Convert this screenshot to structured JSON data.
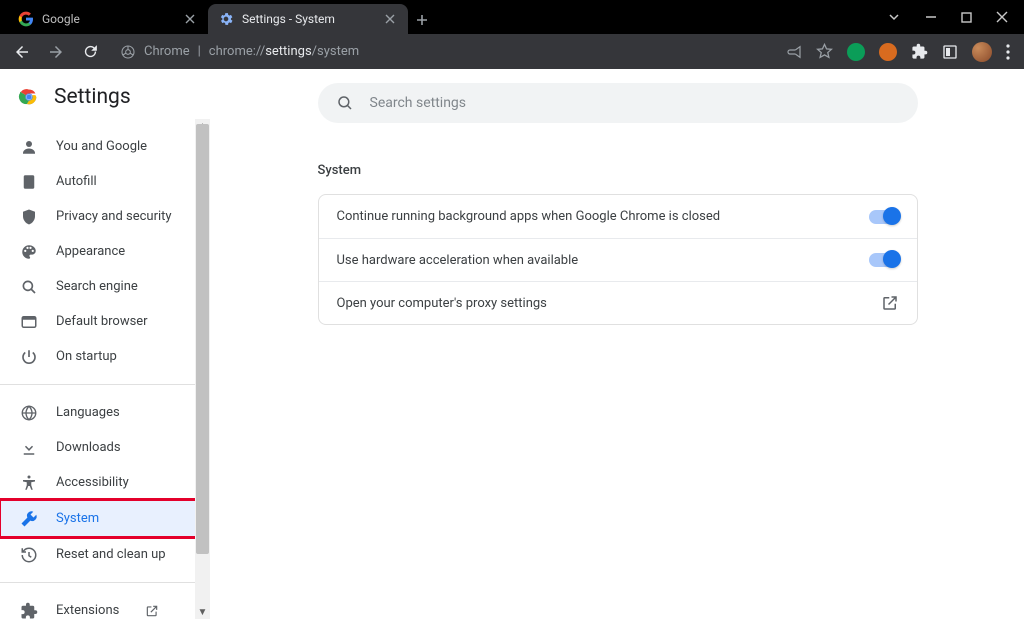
{
  "window": {
    "tabs": [
      {
        "title": "Google",
        "active": false
      },
      {
        "title": "Settings - System",
        "active": true
      }
    ]
  },
  "addressbar": {
    "chrome_label": "Chrome",
    "url_prefix": "chrome://",
    "url_bold": "settings",
    "url_suffix": "/system"
  },
  "settings": {
    "title": "Settings",
    "search_placeholder": "Search settings",
    "section_title": "System",
    "sidebar": {
      "group1": [
        {
          "key": "you-and-google",
          "label": "You and Google",
          "icon": "person"
        },
        {
          "key": "autofill",
          "label": "Autofill",
          "icon": "assignment"
        },
        {
          "key": "privacy",
          "label": "Privacy and security",
          "icon": "shield"
        },
        {
          "key": "appearance",
          "label": "Appearance",
          "icon": "palette"
        },
        {
          "key": "search-engine",
          "label": "Search engine",
          "icon": "search"
        },
        {
          "key": "default-browser",
          "label": "Default browser",
          "icon": "browser"
        },
        {
          "key": "on-startup",
          "label": "On startup",
          "icon": "power"
        }
      ],
      "group2": [
        {
          "key": "languages",
          "label": "Languages",
          "icon": "globe"
        },
        {
          "key": "downloads",
          "label": "Downloads",
          "icon": "download"
        },
        {
          "key": "accessibility",
          "label": "Accessibility",
          "icon": "accessibility"
        },
        {
          "key": "system",
          "label": "System",
          "icon": "wrench",
          "selected": true,
          "highlighted": true
        },
        {
          "key": "reset",
          "label": "Reset and clean up",
          "icon": "restore"
        }
      ],
      "group3": [
        {
          "key": "extensions",
          "label": "Extensions",
          "icon": "extension",
          "external": true
        }
      ]
    },
    "rows": [
      {
        "key": "bg-apps",
        "label": "Continue running background apps when Google Chrome is closed",
        "type": "toggle",
        "value": true
      },
      {
        "key": "hw-accel",
        "label": "Use hardware acceleration when available",
        "type": "toggle",
        "value": true
      },
      {
        "key": "proxy",
        "label": "Open your computer's proxy settings",
        "type": "external"
      }
    ]
  }
}
